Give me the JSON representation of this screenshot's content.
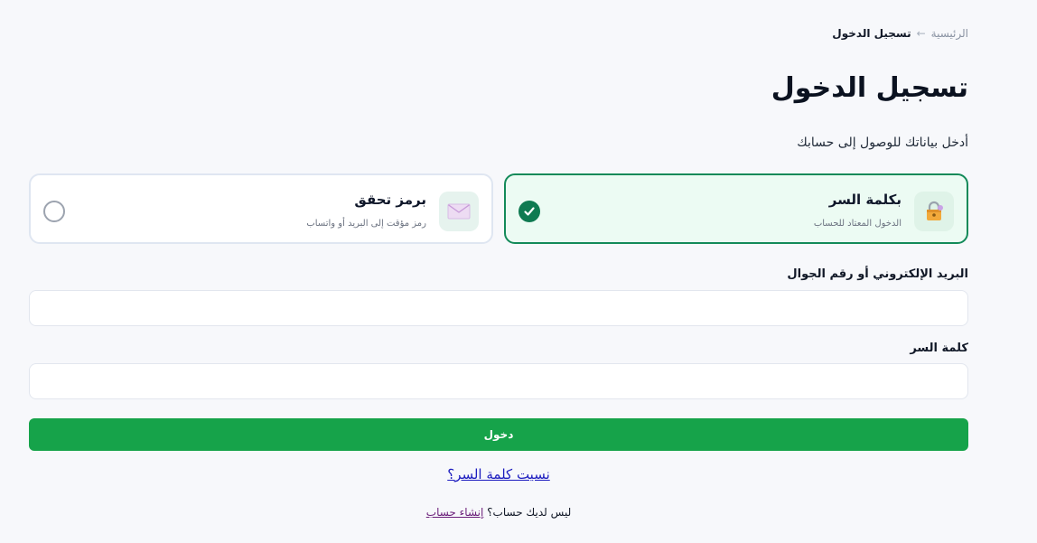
{
  "breadcrumb": {
    "home": "الرئيسية",
    "separator": "←",
    "current": "تسجيل الدخول"
  },
  "page": {
    "title": "تسجيل الدخول",
    "subtitle": "أدخل بياناتك للوصول إلى حسابك"
  },
  "methods": {
    "password": {
      "title": "بكلمة السر",
      "description": "الدخول المعتاد للحساب",
      "icon": "lock-icon",
      "selected": true
    },
    "otp": {
      "title": "برمز تحقق",
      "description": "رمز مؤقت إلى البريد أو واتساب",
      "icon": "envelope-icon",
      "selected": false
    }
  },
  "form": {
    "identifier_label": "البريد الإلكتروني أو رقم الجوال",
    "identifier_value": "",
    "password_label": "كلمة السر",
    "password_value": "",
    "submit_label": "دخول"
  },
  "links": {
    "forgot_password": "نسيت كلمة السر؟",
    "no_account": "ليس لديك حساب؟",
    "create_account": "إنشاء حساب"
  },
  "colors": {
    "accent": "#16a34a",
    "selected_border": "#138a59",
    "selected_bg": "#ecfbf3",
    "link": "#1d1dbf"
  }
}
